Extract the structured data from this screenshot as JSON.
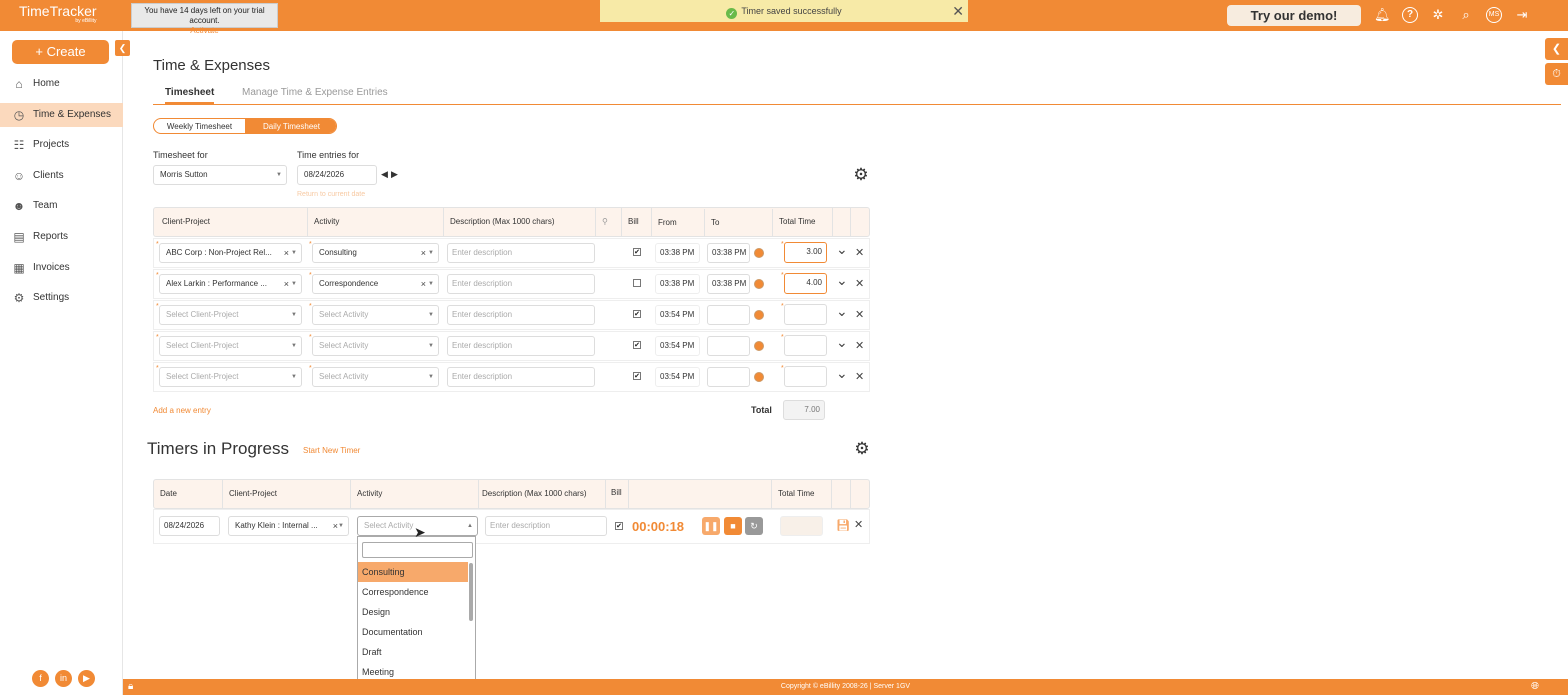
{
  "topbar": {
    "logo": "TimeTracker",
    "logo_sub": "by eBillity",
    "trial_msg": "You have 14 days left on your trial account.",
    "trial_link": "Activate",
    "toast": "Timer saved successfully",
    "demo_button": "Try our demo!",
    "avatar": "MS",
    "icons": [
      "bell-icon",
      "help-icon",
      "tools-icon",
      "search-icon",
      "avatar",
      "logout-icon"
    ]
  },
  "sidebar": {
    "create": "+ Create",
    "items": [
      {
        "label": "Home",
        "icon": "home-icon",
        "active": false
      },
      {
        "label": "Time & Expenses",
        "icon": "clock-icon",
        "active": true
      },
      {
        "label": "Projects",
        "icon": "projects-icon",
        "active": false
      },
      {
        "label": "Clients",
        "icon": "clients-icon",
        "active": false
      },
      {
        "label": "Team",
        "icon": "team-icon",
        "active": false
      },
      {
        "label": "Reports",
        "icon": "reports-icon",
        "active": false
      },
      {
        "label": "Invoices",
        "icon": "invoices-icon",
        "active": false
      },
      {
        "label": "Settings",
        "icon": "settings-icon",
        "active": false
      }
    ]
  },
  "page": {
    "title": "Time & Expenses",
    "tabs": [
      "Timesheet",
      "Manage Time & Expense Entries"
    ],
    "segments": [
      "Weekly Timesheet",
      "Daily Timesheet"
    ],
    "timesheet_for_label": "Timesheet for",
    "timesheet_for_value": "Morris Sutton",
    "time_entries_label": "Time entries for",
    "date": "08/24/2026",
    "return_hint": "Return to current date"
  },
  "table": {
    "headers": [
      "Client-Project",
      "Activity",
      "Description (Max 1000 chars)",
      "",
      "Bill",
      "From",
      "To",
      "Total Time"
    ],
    "rows": [
      {
        "client": "ABC Corp : Non-Project Rel...",
        "activity": "Consulting",
        "desc": "Enter description",
        "bill": true,
        "from": "03:38 PM",
        "to": "03:38 PM",
        "total": "3.00"
      },
      {
        "client": "Alex Larkin : Performance ...",
        "activity": "Correspondence",
        "desc": "Enter description",
        "bill": false,
        "from": "03:38 PM",
        "to": "03:38 PM",
        "total": "4.00"
      },
      {
        "client": "Select Client-Project",
        "activity": "Select Activity",
        "desc": "Enter description",
        "bill": true,
        "from": "03:54 PM",
        "to": "",
        "total": ""
      },
      {
        "client": "Select Client-Project",
        "activity": "Select Activity",
        "desc": "Enter description",
        "bill": true,
        "from": "03:54 PM",
        "to": "",
        "total": ""
      },
      {
        "client": "Select Client-Project",
        "activity": "Select Activity",
        "desc": "Enter description",
        "bill": true,
        "from": "03:54 PM",
        "to": "",
        "total": ""
      }
    ],
    "add_entry": "Add a new entry",
    "total_label": "Total",
    "total_value": "7.00"
  },
  "timers": {
    "title": "Timers in Progress",
    "start_new": "Start New Timer",
    "headers": [
      "Date",
      "Client-Project",
      "Activity",
      "Description (Max 1000 chars)",
      "Bill",
      "",
      "Total Time"
    ],
    "row": {
      "date": "08/24/2026",
      "client": "Kathy Klein : Internal ...",
      "activity_placeholder": "Select Activity",
      "desc": "Enter description",
      "bill": true,
      "elapsed": "00:00:18"
    }
  },
  "dropdown": {
    "options": [
      "Consulting",
      "Correspondence",
      "Design",
      "Documentation",
      "Draft",
      "Meeting"
    ],
    "highlighted": "Consulting"
  },
  "footer": {
    "copyright": "Copyright © eBillity 2008-26 | Server 1GV"
  },
  "colors": {
    "accent": "#f18a35",
    "active_nav": "#fbd9bd",
    "toast": "#f7eaa7"
  }
}
